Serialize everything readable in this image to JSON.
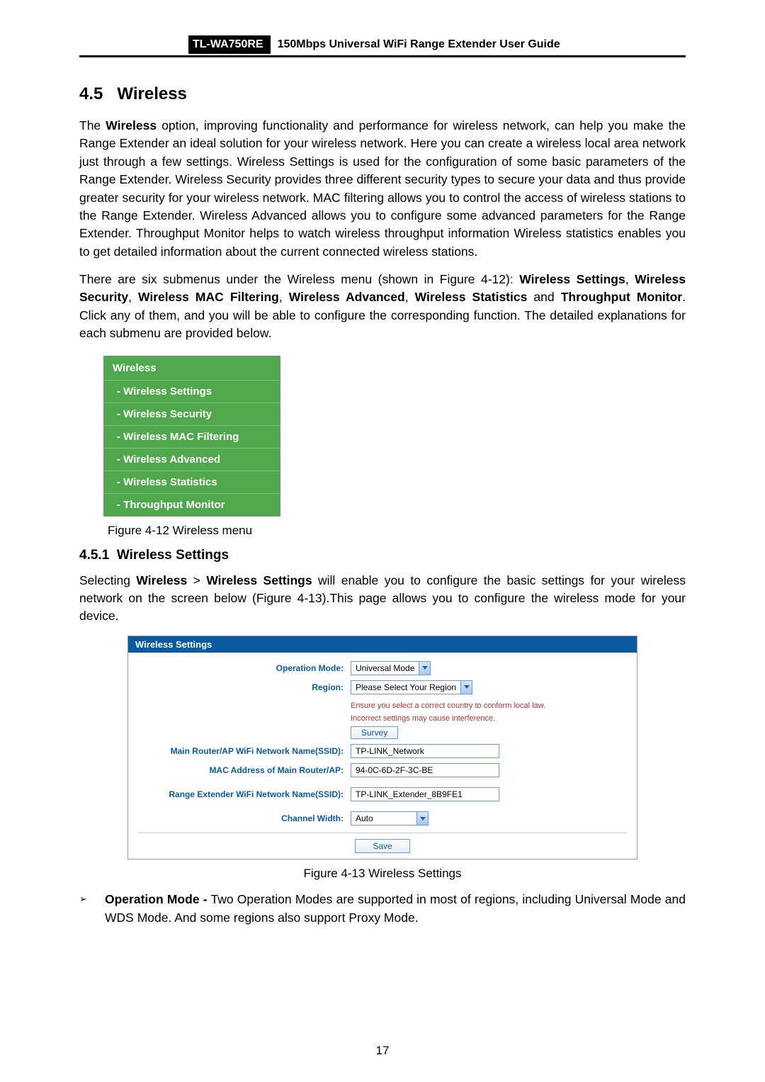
{
  "header": {
    "model": "TL-WA750RE",
    "title": "150Mbps Universal WiFi Range Extender User Guide"
  },
  "section": {
    "number": "4.5",
    "title": "Wireless"
  },
  "para1_parts": {
    "a": "The ",
    "b": "Wireless",
    "c": " option, improving functionality and performance for wireless network, can help you make the Range Extender an ideal solution for your wireless network. Here you can create a wireless local area network just through a few settings. Wireless Settings is used for the configuration of some basic parameters of the Range Extender. Wireless Security provides three different security types to secure your data and thus provide greater security for your wireless network. MAC filtering allows you to control the access of wireless stations to the Range Extender. Wireless Advanced allows you to configure some advanced parameters for the Range Extender. Throughput Monitor helps to watch wireless throughput information Wireless statistics enables you to get detailed information about the current connected wireless stations."
  },
  "para2_parts": {
    "a": "There are six submenus under the Wireless menu (shown in Figure 4-12): ",
    "b1": "Wireless Settings",
    "c1": ", ",
    "b2": "Wireless Security",
    "c2": ", ",
    "b3": "Wireless MAC Filtering",
    "c3": ", ",
    "b4": "Wireless Advanced",
    "c4": ", ",
    "b5": "Wireless Statistics",
    "c5": " and ",
    "b6": "Throughput Monitor",
    "c6": ". Click any of them, and you will be able to configure the corresponding function. The detailed explanations for each submenu are provided below."
  },
  "sidebar": {
    "head": "Wireless",
    "items": [
      "- Wireless Settings",
      "- Wireless Security",
      "- Wireless MAC Filtering",
      "- Wireless Advanced",
      "- Wireless Statistics",
      "- Throughput Monitor"
    ]
  },
  "fig12_caption": "Figure 4-12 Wireless menu",
  "subsection": {
    "number": "4.5.1",
    "title": "Wireless Settings"
  },
  "para3_parts": {
    "a": "Selecting ",
    "b1": "Wireless",
    "c1": " > ",
    "b2": "Wireless Settings",
    "c2": " will enable you to configure the basic settings for your wireless network on the screen below (Figure 4-13).This page allows you to configure the wireless mode for your device."
  },
  "settings": {
    "panel_title": "Wireless Settings",
    "labels": {
      "operation_mode": "Operation Mode:",
      "region": "Region:",
      "main_ssid": "Main Router/AP WiFi Network Name(SSID):",
      "mac_main": "MAC Address of Main Router/AP:",
      "extender_ssid": "Range Extender WiFi Network Name(SSID):",
      "channel_width": "Channel Width:"
    },
    "values": {
      "operation_mode": "Universal Mode",
      "region": "Please Select Your Region",
      "hint1": "Ensure you select a correct country to conform local law.",
      "hint2": "Incorrect settings may cause interference.",
      "survey_btn": "Survey",
      "main_ssid": "TP-LINK_Network",
      "mac_main": "94-0C-6D-2F-3C-BE",
      "extender_ssid": "TP-LINK_Extender_8B9FE1",
      "channel_width": "Auto",
      "save_btn": "Save"
    }
  },
  "fig13_caption": "Figure 4-13 Wireless Settings",
  "bullet": {
    "mark": "➢",
    "b": "Operation Mode -",
    "rest": " Two Operation Modes are supported in most of regions, including Universal Mode and WDS Mode. And some regions also support Proxy Mode."
  },
  "page_number": "17",
  "chart_data": null
}
